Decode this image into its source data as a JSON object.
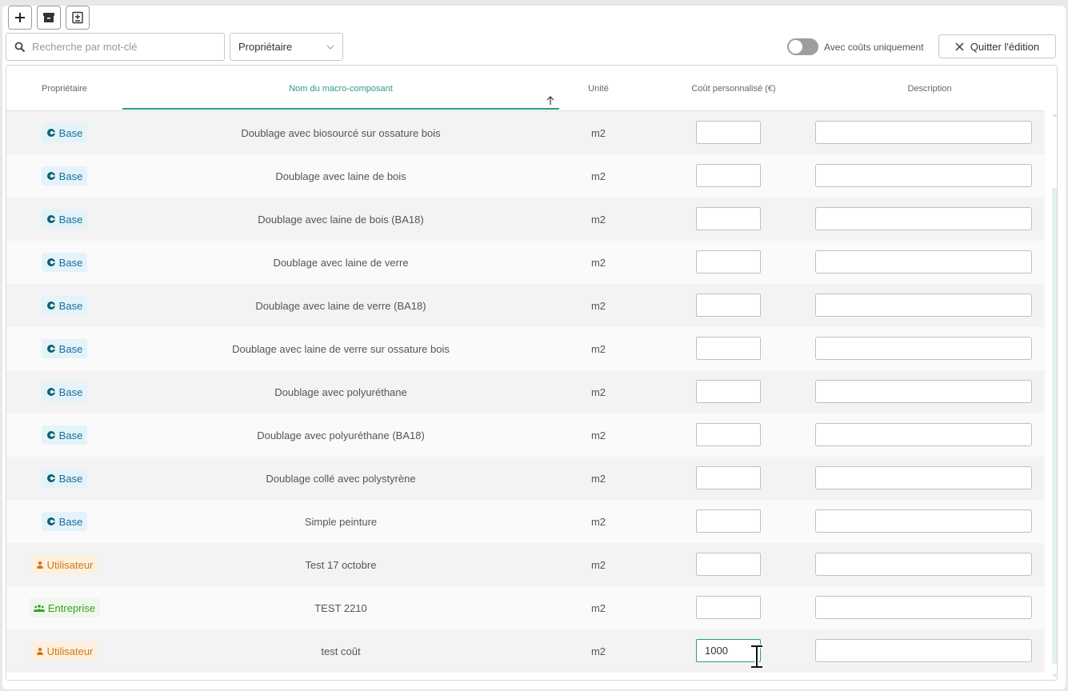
{
  "toolbar": {
    "add_icon": "plus-icon",
    "archive_icon": "archive-icon",
    "import_icon": "import-icon"
  },
  "search": {
    "placeholder": "Recherche par mot-clé",
    "value": ""
  },
  "owner_filter": {
    "selected": "Propriétaire"
  },
  "cost_toggle": {
    "label": "Avec coûts uniquement",
    "on": false
  },
  "quit_button": {
    "label": "Quitter l'édition"
  },
  "table": {
    "headers": {
      "owner": "Propriétaire",
      "name": "Nom du macro-composant",
      "unit": "Unité",
      "cost": "Coût personnalisé (€)",
      "description": "Description"
    },
    "sort": {
      "column": "name",
      "direction": "asc"
    },
    "rows": [
      {
        "owner": "Base",
        "owner_type": "base",
        "name": "Doublage avec biosourcé sur ossature bois",
        "unit": "m2",
        "cost": "",
        "description": ""
      },
      {
        "owner": "Base",
        "owner_type": "base",
        "name": "Doublage avec laine de bois",
        "unit": "m2",
        "cost": "",
        "description": ""
      },
      {
        "owner": "Base",
        "owner_type": "base",
        "name": "Doublage avec laine de bois (BA18)",
        "unit": "m2",
        "cost": "",
        "description": ""
      },
      {
        "owner": "Base",
        "owner_type": "base",
        "name": "Doublage avec laine de verre",
        "unit": "m2",
        "cost": "",
        "description": ""
      },
      {
        "owner": "Base",
        "owner_type": "base",
        "name": "Doublage avec laine de verre (BA18)",
        "unit": "m2",
        "cost": "",
        "description": ""
      },
      {
        "owner": "Base",
        "owner_type": "base",
        "name": "Doublage avec laine de verre sur ossature bois",
        "unit": "m2",
        "cost": "",
        "description": ""
      },
      {
        "owner": "Base",
        "owner_type": "base",
        "name": "Doublage avec polyuréthane",
        "unit": "m2",
        "cost": "",
        "description": ""
      },
      {
        "owner": "Base",
        "owner_type": "base",
        "name": "Doublage avec polyuréthane (BA18)",
        "unit": "m2",
        "cost": "",
        "description": ""
      },
      {
        "owner": "Base",
        "owner_type": "base",
        "name": "Doublage collé avec polystyrène",
        "unit": "m2",
        "cost": "",
        "description": ""
      },
      {
        "owner": "Base",
        "owner_type": "base",
        "name": "Simple peinture",
        "unit": "m2",
        "cost": "",
        "description": ""
      },
      {
        "owner": "Utilisateur",
        "owner_type": "user",
        "name": "Test 17 octobre",
        "unit": "m2",
        "cost": "",
        "description": ""
      },
      {
        "owner": "Entreprise",
        "owner_type": "ent",
        "name": "TEST 2210",
        "unit": "m2",
        "cost": "",
        "description": ""
      },
      {
        "owner": "Utilisateur",
        "owner_type": "user",
        "name": "test coût",
        "unit": "m2",
        "cost": "1000",
        "description": ""
      }
    ]
  },
  "colors": {
    "accent": "#2b9b8a",
    "base_badge": "#1a6e9a",
    "user_badge": "#d07a12",
    "ent_badge": "#3b9a2a"
  }
}
